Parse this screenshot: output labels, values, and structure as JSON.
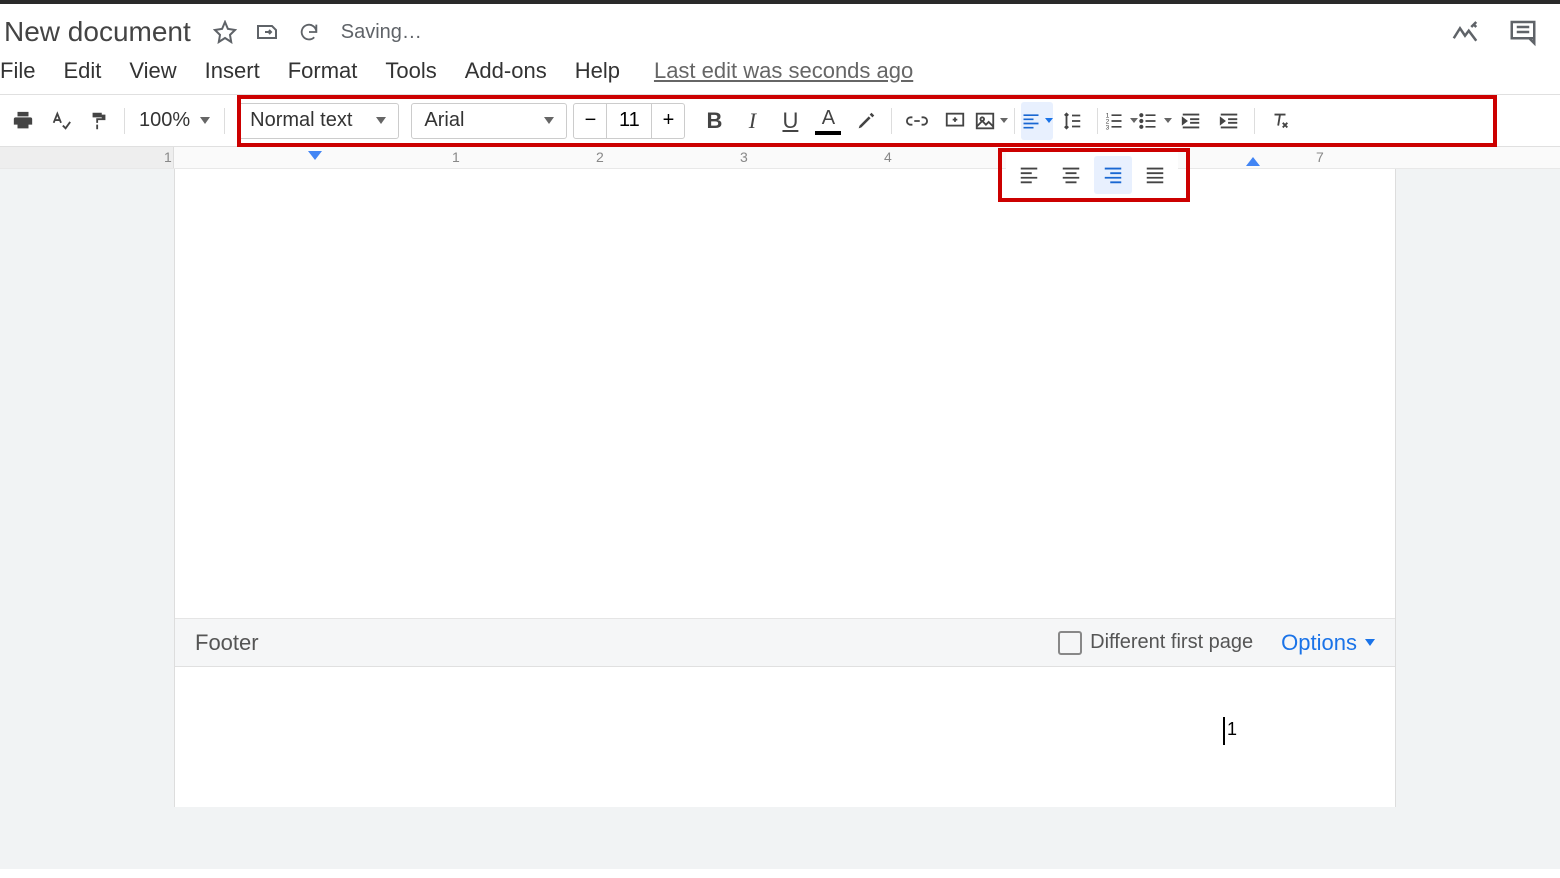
{
  "header": {
    "title": "New document",
    "saving": "Saving…"
  },
  "menu": {
    "file": "File",
    "edit": "Edit",
    "view": "View",
    "insert": "Insert",
    "format": "Format",
    "tools": "Tools",
    "addons": "Add-ons",
    "help": "Help",
    "last_edit": "Last edit was seconds ago"
  },
  "toolbar": {
    "zoom": "100%",
    "style": "Normal text",
    "font": "Arial",
    "font_size": "11"
  },
  "ruler": {
    "marks": [
      "1",
      "1",
      "2",
      "3",
      "4",
      "7"
    ]
  },
  "footer": {
    "label": "Footer",
    "different_first_page": "Different first page",
    "options": "Options"
  }
}
